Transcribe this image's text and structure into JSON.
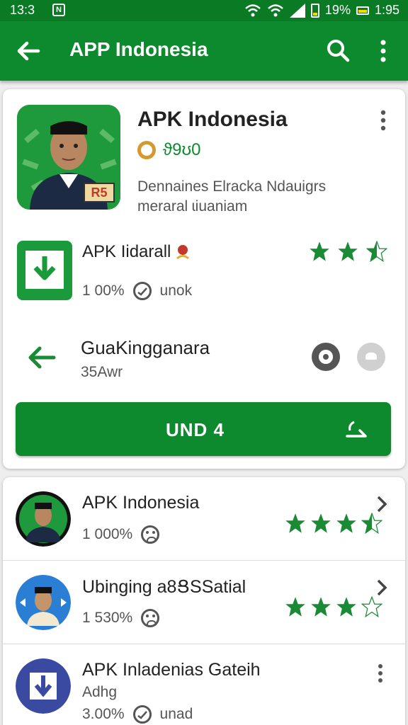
{
  "status_bar": {
    "time_left": "13:3",
    "notification": "N",
    "battery_percent": "19%",
    "time_right": "1:95"
  },
  "app_bar": {
    "title": "APP Indonesia",
    "back_icon": "arrow-left-icon",
    "search_icon": "search-icon",
    "more_icon": "more-vert-icon"
  },
  "header": {
    "title": "APK Indonesia",
    "subtitle": "ϑ9ʊ0",
    "description": "Dennaines Elracka Ndauigrs meraral ɩiuaniam",
    "icon": "portrait-app-icon",
    "badge": "R5"
  },
  "row1": {
    "title": "APK Iidarall",
    "percent": "1 00%",
    "status": "unok",
    "rating_stars": 2.5
  },
  "row2": {
    "title": "GuaKingganara",
    "subtitle": "35Awr"
  },
  "install_button": {
    "label": "UND 4"
  },
  "list": [
    {
      "title": "APK Indonesia",
      "meta": "1 000%",
      "rating_stars": 3.5,
      "trailing": "chevron"
    },
    {
      "title": "Ubinging a8ՑSSatial",
      "meta": "1 530%",
      "rating_stars": 3.5,
      "trailing": "chevron"
    },
    {
      "title": "APK Inladenias Gateih",
      "sub": "Adhg",
      "meta": "3.00%",
      "status": "unad",
      "trailing": "more"
    }
  ],
  "colors": {
    "primary": "#0e8a2e",
    "status_bar": "#0b7a25",
    "background": "#eeeeee"
  }
}
